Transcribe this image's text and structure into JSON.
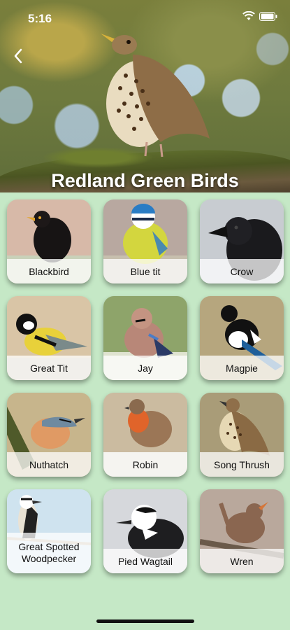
{
  "status": {
    "time": "5:16"
  },
  "header": {
    "title": "Redland Green Birds"
  },
  "birds": [
    {
      "name": "Blackbird"
    },
    {
      "name": "Blue tit"
    },
    {
      "name": "Crow"
    },
    {
      "name": "Great Tit"
    },
    {
      "name": "Jay"
    },
    {
      "name": "Magpie"
    },
    {
      "name": "Nuthatch"
    },
    {
      "name": "Robin"
    },
    {
      "name": "Song Thrush"
    },
    {
      "name": "Great Spotted Woodpecker"
    },
    {
      "name": "Pied Wagtail"
    },
    {
      "name": "Wren"
    }
  ]
}
